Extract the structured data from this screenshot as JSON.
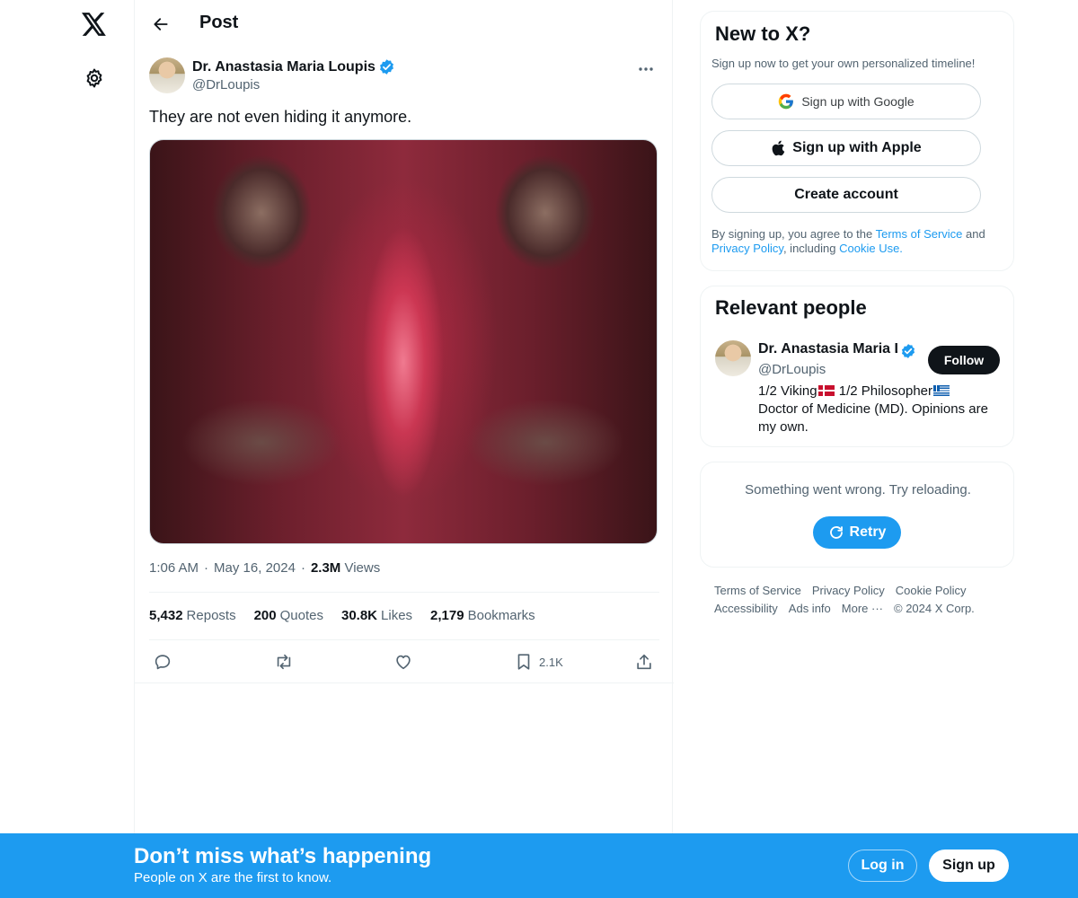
{
  "topbar": {
    "title": "Post"
  },
  "post": {
    "author_name": "Dr. Anastasia Maria Loupis",
    "author_handle": "@DrLoupis",
    "text": "They are not even hiding it anymore.",
    "time": "1:06 AM",
    "date": "May 16, 2024",
    "views_count": "2.3M",
    "views_label": "Views",
    "stats": {
      "reposts_count": "5,432",
      "reposts_label": "Reposts",
      "quotes_count": "200",
      "quotes_label": "Quotes",
      "likes_count": "30.8K",
      "likes_label": "Likes",
      "bookmarks_count": "2,179",
      "bookmarks_label": "Bookmarks"
    },
    "actions": {
      "bookmark_count": "2.1K"
    }
  },
  "signup_card": {
    "title": "New to X?",
    "subtitle": "Sign up now to get your own personalized timeline!",
    "google_label": "Sign up with Google",
    "apple_label": "Sign up with Apple",
    "create_label": "Create account",
    "legal_prefix": "By signing up, you agree to the ",
    "terms_link": "Terms of Service",
    "legal_and": " and ",
    "privacy_link": "Privacy Policy",
    "legal_including": ", including ",
    "cookie_link": "Cookie Use."
  },
  "relevant_people": {
    "title": "Relevant people",
    "name": "Dr. Anastasia Maria Loupis",
    "handle": "@DrLoupis",
    "follow_label": "Follow",
    "bio_part1": "1/2 Viking",
    "bio_part2": " 1/2 Philosopher",
    "bio_part3": "Doctor of Medicine (MD). Opinions are my own."
  },
  "error_card": {
    "message": "Something went wrong. Try reloading.",
    "retry_label": "Retry"
  },
  "footer": {
    "terms": "Terms of Service",
    "privacy": "Privacy Policy",
    "cookie": "Cookie Policy",
    "accessibility": "Accessibility",
    "ads": "Ads info",
    "more": "More ···",
    "copyright": "© 2024 X Corp."
  },
  "bottom_bar": {
    "title": "Don’t miss what’s happening",
    "subtitle": "People on X are the first to know.",
    "login_label": "Log in",
    "signup_label": "Sign up"
  },
  "colors": {
    "accent": "#1d9bf0",
    "text": "#0f1419",
    "muted": "#536471"
  }
}
